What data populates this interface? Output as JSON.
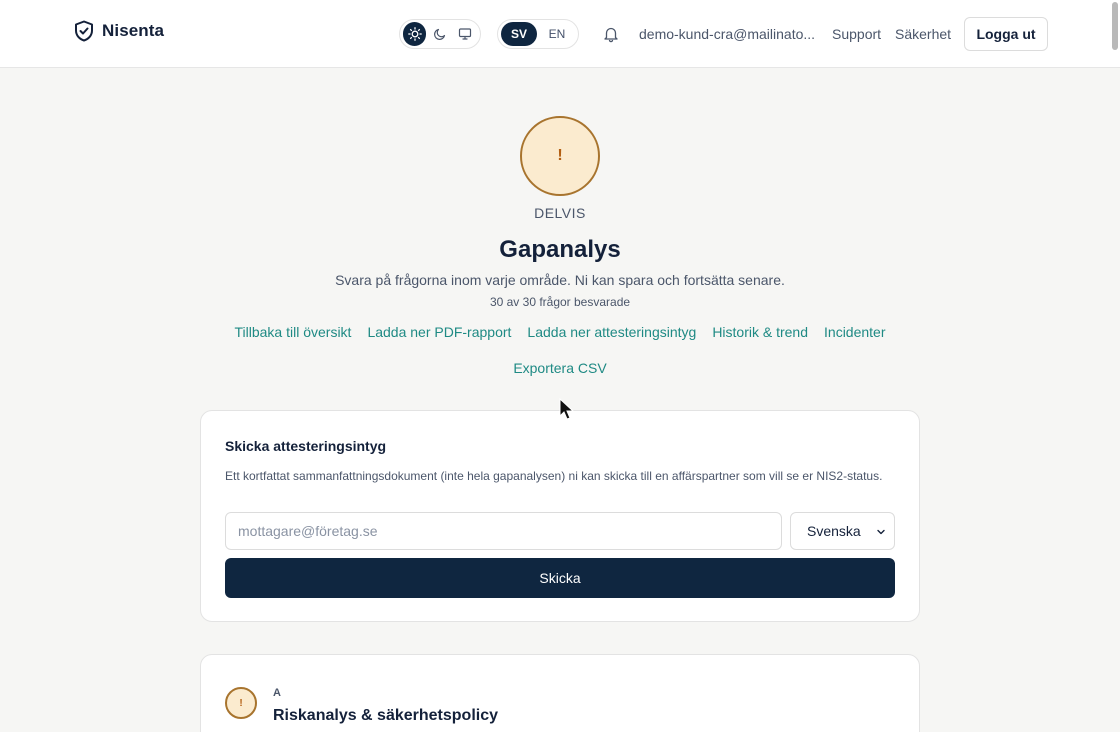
{
  "header": {
    "brand": "Nisenta",
    "theme": {
      "options": [
        "light",
        "dark",
        "system"
      ],
      "active": "light"
    },
    "language": {
      "options": [
        "SV",
        "EN"
      ],
      "active": "SV"
    },
    "user_email": "demo-kund-cra@mailinato...",
    "links": [
      "Support",
      "Säkerhet"
    ],
    "logout_label": "Logga ut"
  },
  "hero": {
    "status_symbol": "!",
    "status_label": "DELVIS",
    "title": "Gapanalys",
    "subtitle": "Svara på frågorna inom varje område. Ni kan spara och fortsätta senare.",
    "progress_text": "30 av 30 frågor besvarade",
    "links": [
      "Tillbaka till översikt",
      "Ladda ner PDF-rapport",
      "Ladda ner attesteringsintyg",
      "Historik & trend",
      "Incidenter"
    ],
    "links_row2": [
      "Exportera CSV"
    ]
  },
  "attestation": {
    "title": "Skicka attesteringsintyg",
    "description": "Ett kortfattat sammanfattningsdokument (inte hela gapanalysen) ni kan skicka till en affärspartner som vill se er NIS2-status.",
    "email_placeholder": "mottagare@företag.se",
    "language_selected": "Svenska",
    "send_label": "Skicka"
  },
  "section": {
    "badge_symbol": "!",
    "letter": "A",
    "title": "Riskanalys & säkerhetspolicy"
  },
  "colors": {
    "primary": "#0f2640",
    "link": "#1f8a84",
    "warning_border": "#a8742e",
    "warning_fill": "#fbebcf",
    "background": "#f6f6f4"
  }
}
